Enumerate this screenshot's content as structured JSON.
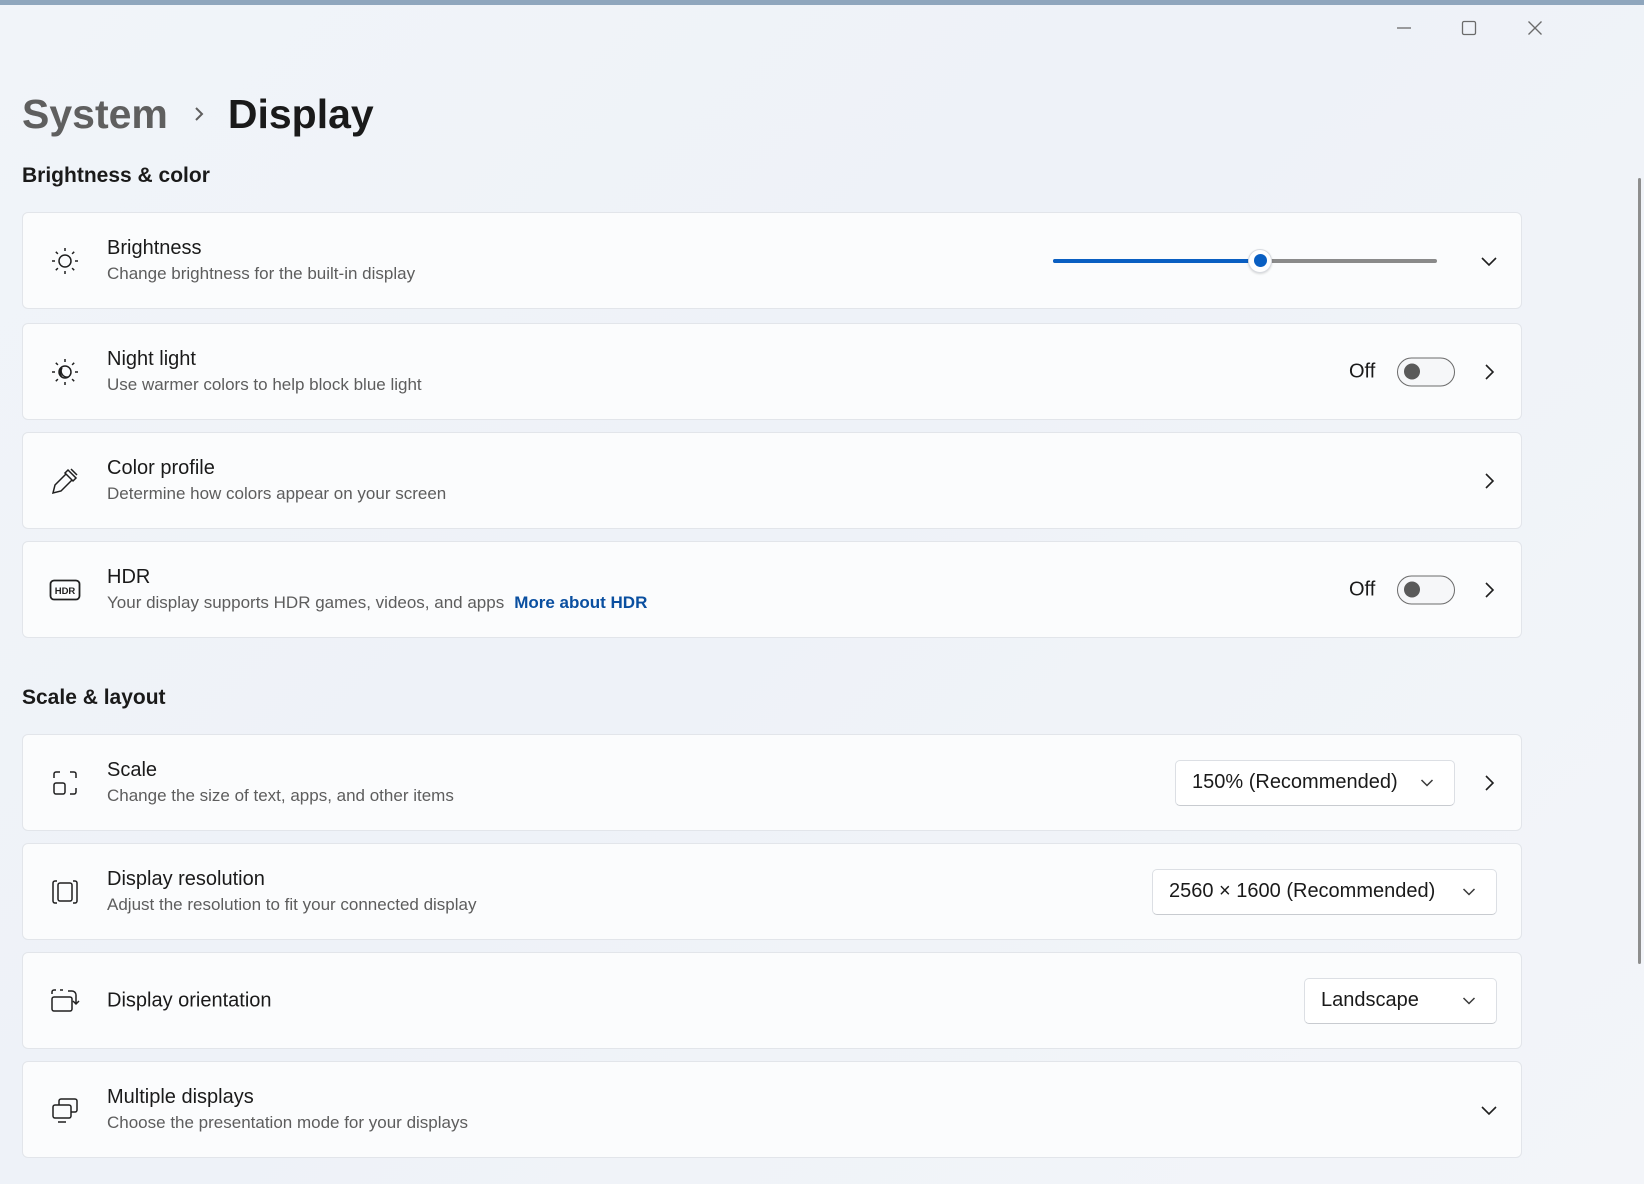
{
  "window": {
    "minimize_label": "Minimize",
    "maximize_label": "Maximize",
    "close_label": "Close"
  },
  "breadcrumb": {
    "parent": "System",
    "current": "Display"
  },
  "sections": {
    "brightness_color": "Brightness & color",
    "scale_layout": "Scale & layout"
  },
  "brightness": {
    "title": "Brightness",
    "description": "Change brightness for the built-in display",
    "level_percent": 54,
    "icon": "sun-icon"
  },
  "night_light": {
    "title": "Night light",
    "description": "Use warmer colors to help block blue light",
    "state_label": "Off",
    "icon": "night-light-icon"
  },
  "color_profile": {
    "title": "Color profile",
    "description": "Determine how colors appear on your screen",
    "icon": "eyedropper-icon"
  },
  "hdr": {
    "title": "HDR",
    "description": "Your display supports HDR games, videos, and apps",
    "link": "More about HDR",
    "state_label": "Off",
    "icon_text": "HDR",
    "icon": "hdr-icon"
  },
  "scale": {
    "title": "Scale",
    "description": "Change the size of text, apps, and other items",
    "value": "150% (Recommended)",
    "icon": "scale-icon"
  },
  "resolution": {
    "title": "Display resolution",
    "description": "Adjust the resolution to fit your connected display",
    "value": "2560 × 1600 (Recommended)",
    "icon": "resolution-icon"
  },
  "orientation": {
    "title": "Display orientation",
    "value": "Landscape",
    "icon": "orientation-icon"
  },
  "multiple_displays": {
    "title": "Multiple displays",
    "description": "Choose the presentation mode for your displays",
    "icon": "multiple-displays-icon"
  },
  "colors": {
    "accent": "#0a5fc2",
    "link": "#0a4fa0"
  }
}
